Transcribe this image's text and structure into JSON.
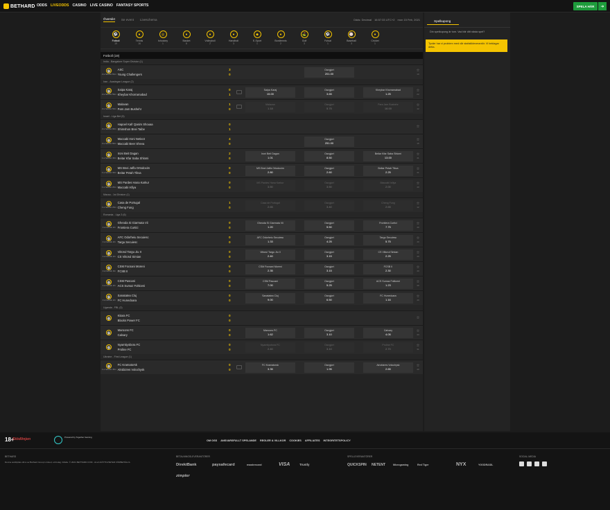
{
  "brand": {
    "name": "BETHARD",
    "sub": "WINNERS DARE MORE"
  },
  "nav": [
    "ODDS",
    "LIVEODDS",
    "CASINO",
    "LIVE CASINO",
    "FANTASY SPORTS"
  ],
  "header": {
    "play": "SPELA HÄR"
  },
  "subnav": [
    "Översikt",
    "Se event",
    "Liveschema"
  ],
  "odds_settings": [
    "Odds: Decimal",
    "16:57:33 UTC+2",
    "mon 15 Feb, 2021"
  ],
  "sports": [
    {
      "name": "Fotboll",
      "count": "19"
    },
    {
      "name": "Tennis",
      "count": "16"
    },
    {
      "name": "Ishockey",
      "count": "1"
    },
    {
      "name": "Basket",
      "count": "8"
    },
    {
      "name": "Volleyboll",
      "count": "2"
    },
    {
      "name": "Handboll",
      "count": "3"
    },
    {
      "name": "E-Sport",
      "count": "1"
    },
    {
      "name": "Bordtennis",
      "count": "2"
    },
    {
      "name": "Golf",
      "count": "3"
    },
    {
      "name": "Futsal",
      "count": "1"
    },
    {
      "name": "Baseball",
      "count": "3"
    },
    {
      "name": "Cricket",
      "count": "1"
    }
  ],
  "section_title": "Fotboll (19)",
  "leagues": [
    {
      "name": "India - Bangalore Super Division (1)",
      "matches": [
        {
          "time": "2:a halvlek 81m",
          "home": "ASC",
          "away": "Young Challengers",
          "sh": "3",
          "sa": "0",
          "stat": false,
          "odds": [
            {
              "empty": true
            },
            {
              "l": "Oavgjort",
              "v": "201.00"
            },
            {
              "empty": true
            }
          ],
          "more": "10"
        }
      ]
    },
    {
      "name": "Iran - Azadegan League (2)",
      "matches": [
        {
          "time": "2:a halvlek 59m",
          "home": "Saipa Karaj",
          "away": "Kheybar Khorramabad",
          "sh": "0",
          "sa": "1",
          "stat": true,
          "odds": [
            {
              "l": "Saipa Karaj",
              "v": "15.00"
            },
            {
              "l": "Oavgjort",
              "v": "3.65"
            },
            {
              "l": "Kheybar Khorramabad",
              "v": "1.25"
            }
          ],
          "more": "22"
        },
        {
          "time": "2:a halvlek 54m",
          "home": "Malavan",
          "away": "Pars Jam Bushehr",
          "sh": "1",
          "sa": "0",
          "stat": true,
          "dim": true,
          "odds": [
            {
              "l": "Malavan",
              "v": "1.18"
            },
            {
              "l": "Oavgjort",
              "v": "5.75"
            },
            {
              "l": "Pars Jam Bushehr",
              "v": "16.00"
            }
          ],
          "more": "12"
        }
      ]
    },
    {
      "name": "Israel - Liga Bet (5)",
      "matches": [
        {
          "time": "2:a halvlek 90m",
          "home": "Hapoel Kafr Qasim Shouaa",
          "away": "Shimshon Bnei Taibe",
          "sh": "0",
          "sa": "1",
          "stat": false,
          "odds": [
            {
              "empty": true
            },
            {
              "empty": true
            },
            {
              "empty": true
            }
          ],
          "more": ""
        },
        {
          "time": "2:a halvlek 82m",
          "home": "Maccabi Ironi Netivot",
          "away": "Maccabi Beer Sheva",
          "sh": "4",
          "sa": "0",
          "stat": false,
          "odds": [
            {
              "empty": true
            },
            {
              "l": "Oavgjort",
              "v": "251.00"
            },
            {
              "empty": true
            }
          ],
          "more": "15"
        },
        {
          "time": "1:a halvlek 40m",
          "home": "Ironi Beit Dagan",
          "away": "Beitar Kfar Saba Shlomi",
          "sh": "2",
          "sa": "0",
          "stat": false,
          "odds": [
            {
              "l": "Ironi Beit Dagan",
              "v": "1.01"
            },
            {
              "l": "Oavgjort",
              "v": "8.50"
            },
            {
              "l": "Beitar Kfar Saba Shlomi",
              "v": "13.00"
            }
          ],
          "more": "41"
        },
        {
          "time": "1:a halvlek 32m",
          "home": "MS Bnei Jaffa Ortodoxim",
          "away": "Beitar Petah Tikva",
          "sh": "0",
          "sa": "0",
          "stat": false,
          "odds": [
            {
              "l": "MS Bnei Jaffa Ortodoxim",
              "v": "2.80"
            },
            {
              "l": "Oavgjort",
              "v": "2.60"
            },
            {
              "l": "Beitar Petah Tikva",
              "v": "2.25"
            }
          ],
          "more": "41"
        },
        {
          "time": "1:a halvlek 20m",
          "home": "MS Pardes Hana Karkur",
          "away": "Maccabi Isfiya",
          "sh": "0",
          "sa": "0",
          "stat": false,
          "dim": true,
          "odds": [
            {
              "l": "MS Pardes Hana Karkur",
              "v": "3.50"
            },
            {
              "l": "Oavgjort",
              "v": "3.50"
            },
            {
              "l": "Maccabi Isfiya",
              "v": "2.00"
            }
          ],
          "more": "40"
        }
      ]
    },
    {
      "name": "Macau - 1st Division (1)",
      "matches": [
        {
          "time": "1:a halvlek 23m",
          "home": "Casa de Portugal",
          "away": "Cheng Fung",
          "sh": "1",
          "sa": "0",
          "stat": false,
          "dim": true,
          "odds": [
            {
              "l": "Casa de Portugal",
              "v": "2.65"
            },
            {
              "l": "Oavgjort",
              "v": "3.40"
            },
            {
              "l": "Cheng Fung",
              "v": "2.65"
            }
          ],
          "more": "12"
        }
      ]
    },
    {
      "name": "Romania - Liga 3 (6)",
      "matches": [
        {
          "time": "1:a halvlek 2m",
          "home": "Gheoda Si Giarmata Vii",
          "away": "Frontiera Curtici",
          "sh": "0",
          "sa": "0",
          "stat": false,
          "odds": [
            {
              "l": "Gheoda Si Giarmata Vii",
              "v": "1.20"
            },
            {
              "l": "Oavgjort",
              "v": "5.50"
            },
            {
              "l": "Frontiera Curtici",
              "v": "7.75"
            }
          ],
          "more": "40"
        },
        {
          "time": "1:a halvlek 2m",
          "home": "AFC Odorheiu Secuiesc",
          "away": "Targu Secuiesc",
          "sh": "0",
          "sa": "0",
          "stat": false,
          "odds": [
            {
              "l": "AFC Odorheiu Secuiesc",
              "v": "1.33"
            },
            {
              "l": "Oavgjort",
              "v": "4.25"
            },
            {
              "l": "Targu Secuiesc",
              "v": "5.75"
            }
          ],
          "more": "40"
        },
        {
          "time": "1:a halvlek 2m",
          "home": "Viitorul Targu Jiu II",
          "away": "CS Viitorul Simian",
          "sh": "0",
          "sa": "0",
          "stat": false,
          "odds": [
            {
              "l": "Viitorul Targu Jiu II",
              "v": "2.40"
            },
            {
              "l": "Oavgjort",
              "v": "3.15"
            },
            {
              "l": "CS Viitorul Simian",
              "v": "2.25"
            }
          ],
          "more": "40"
        },
        {
          "time": "1:a halvlek 0m",
          "home": "CSM Focsani Moreni",
          "away": "FCSB II",
          "sh": "0",
          "sa": "0",
          "stat": false,
          "odds": [
            {
              "l": "CSM Focsani Moreni",
              "v": "2.35"
            },
            {
              "l": "Oavgjort",
              "v": "3.15"
            },
            {
              "l": "FCSB II",
              "v": "2.30"
            }
          ],
          "more": "40"
        },
        {
          "time": "1:a halvlek 2m",
          "home": "CSM Pascani",
          "away": "ACS Sumaz Folticeni",
          "sh": "0",
          "sa": "0",
          "stat": false,
          "odds": [
            {
              "l": "CSM Pascani",
              "v": "7.00"
            },
            {
              "l": "Oavgjort",
              "v": "5.25"
            },
            {
              "l": "ACS Sumaz Folticeni",
              "v": "1.23"
            }
          ],
          "more": "40"
        },
        {
          "time": "1:a halvlek 2m",
          "home": "Sanatatea Cluj",
          "away": "FC Hunedoara",
          "sh": "0",
          "sa": "0",
          "stat": false,
          "odds": [
            {
              "l": "Sanatatea Cluj",
              "v": "9.00"
            },
            {
              "l": "Oavgjort",
              "v": "6.50"
            },
            {
              "l": "FC Hunedoara",
              "v": "1.16"
            }
          ],
          "more": "40"
        }
      ]
    },
    {
      "name": "Uganda - FBL (3)",
      "matches": [
        {
          "time": "",
          "home": "Kitara FC",
          "away": "Blacks Power FC",
          "sh": "0",
          "sa": "0",
          "stat": false,
          "odds": [
            {
              "empty": true
            },
            {
              "empty": true
            },
            {
              "empty": true
            }
          ],
          "more": ""
        },
        {
          "time": "",
          "home": "Maroons FC",
          "away": "Calvary",
          "sh": "0",
          "sa": "0",
          "stat": false,
          "odds": [
            {
              "l": "Maroons FC",
              "v": "1.62"
            },
            {
              "l": "Oavgjort",
              "v": "3.10"
            },
            {
              "l": "Calvary",
              "v": "4.05"
            }
          ],
          "more": "33"
        },
        {
          "time": "",
          "home": "Nyamityobora FC",
          "away": "Proline FC",
          "sh": "0",
          "sa": "0",
          "stat": false,
          "dim": true,
          "odds": [
            {
              "l": "Nyamityobora FC",
              "v": "2.40"
            },
            {
              "l": "Oavgjort",
              "v": "3.10"
            },
            {
              "l": "Proline FC",
              "v": "2.70"
            }
          ],
          "more": "31"
        }
      ]
    },
    {
      "name": "Ukraine - First League (1)",
      "matches": [
        {
          "time": "1:a halvlek 45m",
          "home": "FC Kramatorsk",
          "away": "Alrobizres Volochysk",
          "sh": "0",
          "sa": "0",
          "stat": true,
          "odds": [
            {
              "l": "FC Kramatorsk",
              "v": "3.35"
            },
            {
              "l": "Oavgjort",
              "v": "1.95"
            },
            {
              "l": "Alrobizres Volochysk",
              "v": "2.65"
            }
          ],
          "more": "40"
        }
      ]
    }
  ],
  "side": {
    "tab": "Spelkupong",
    "hint": "Din spelkupong är tom. Vad blir ditt nästa spel?",
    "warn": "Tyvärr har vi problem med vår statistikleverantör. Vi beklagar detta."
  },
  "footer": {
    "links": [
      "OM OSS",
      "ANSVARSFULLT SPELANDE",
      "REGLER & VILLKOR",
      "COOKIES",
      "AFFILIATES",
      "INTEGRITETSPOLICY"
    ],
    "age": "18+",
    "stodlinjen": "Stödlinjen",
    "tg": "Powered by Together Gaming",
    "cols": [
      "BETHARD",
      "BETALNINGSLEVERANTÖRER",
      "SPELLEVERANTÖRER",
      "SOCIAL MEDIA"
    ],
    "legal": "Denna webbplats drivs av Bethard Group Limited, ett bolag i Malta. © 2021 BETHARD.COM - ALLA RÄTTIGHETER FÖRBEHÅLLS.",
    "payments": [
      "DirektBank",
      "paysafecard",
      "mastercard",
      "VISA",
      "Trustly",
      "zimpler"
    ],
    "providers": [
      "QUICKSPIN",
      "NETENT",
      "Microgaming",
      "Red Tiger",
      "NYX",
      "YGGDRASIL"
    ]
  }
}
